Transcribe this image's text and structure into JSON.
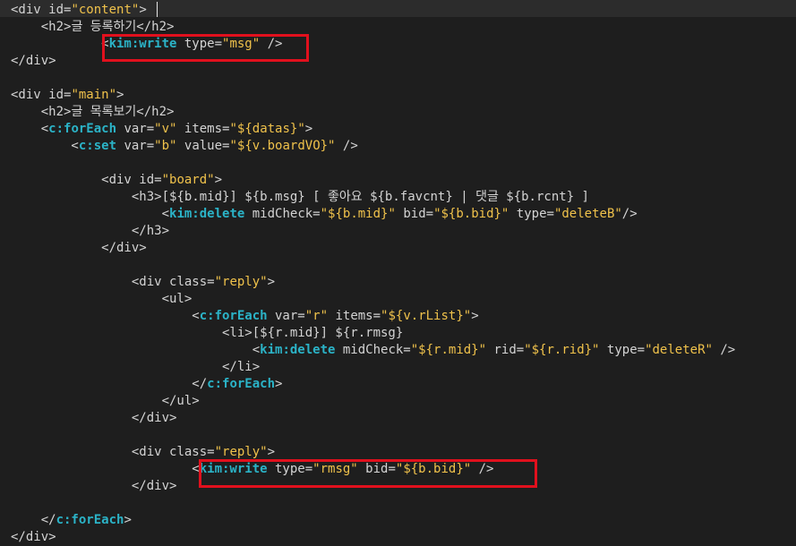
{
  "code_lines": [
    {
      "tokens": [
        {
          "c": "tag",
          "t": "<div "
        },
        {
          "c": "attr",
          "t": "id="
        },
        {
          "c": "str",
          "t": "\"content\""
        },
        {
          "c": "tag",
          "t": ">"
        }
      ]
    },
    {
      "tokens": [
        {
          "c": "tag",
          "t": "    <h2>"
        },
        {
          "c": "text",
          "t": "글 등록하기"
        },
        {
          "c": "tag",
          "t": "</h2>"
        }
      ]
    },
    {
      "tokens": [
        {
          "c": "tag",
          "t": "            <"
        },
        {
          "c": "kim",
          "t": "kim:write"
        },
        {
          "c": "attr",
          "t": " type="
        },
        {
          "c": "str",
          "t": "\"msg\""
        },
        {
          "c": "tag",
          "t": " />"
        }
      ]
    },
    {
      "tokens": [
        {
          "c": "tag",
          "t": "</div>"
        }
      ]
    },
    {
      "tokens": []
    },
    {
      "tokens": [
        {
          "c": "tag",
          "t": "<div "
        },
        {
          "c": "attr",
          "t": "id="
        },
        {
          "c": "str",
          "t": "\"main\""
        },
        {
          "c": "tag",
          "t": ">"
        }
      ]
    },
    {
      "tokens": [
        {
          "c": "tag",
          "t": "    <h2>"
        },
        {
          "c": "text",
          "t": "글 목록보기"
        },
        {
          "c": "tag",
          "t": "</h2>"
        }
      ]
    },
    {
      "tokens": [
        {
          "c": "tag",
          "t": "    <"
        },
        {
          "c": "kim",
          "t": "c:forEach"
        },
        {
          "c": "attr",
          "t": " var="
        },
        {
          "c": "str",
          "t": "\"v\""
        },
        {
          "c": "attr",
          "t": " items="
        },
        {
          "c": "str",
          "t": "\"${datas}\""
        },
        {
          "c": "tag",
          "t": ">"
        }
      ]
    },
    {
      "tokens": [
        {
          "c": "tag",
          "t": "        <"
        },
        {
          "c": "kim",
          "t": "c:set"
        },
        {
          "c": "attr",
          "t": " var="
        },
        {
          "c": "str",
          "t": "\"b\""
        },
        {
          "c": "attr",
          "t": " value="
        },
        {
          "c": "str",
          "t": "\"${v.boardVO}\""
        },
        {
          "c": "tag",
          "t": " />"
        }
      ]
    },
    {
      "tokens": []
    },
    {
      "tokens": [
        {
          "c": "tag",
          "t": "            <div "
        },
        {
          "c": "attr",
          "t": "id="
        },
        {
          "c": "str",
          "t": "\"board\""
        },
        {
          "c": "tag",
          "t": ">"
        }
      ]
    },
    {
      "tokens": [
        {
          "c": "tag",
          "t": "                <h3>"
        },
        {
          "c": "text",
          "t": "[${b.mid}] ${b.msg} [ 좋아요 ${b.favcnt} | 댓글 ${b.rcnt} ]"
        }
      ]
    },
    {
      "tokens": [
        {
          "c": "tag",
          "t": "                    <"
        },
        {
          "c": "kim",
          "t": "kim:delete"
        },
        {
          "c": "attr",
          "t": " midCheck="
        },
        {
          "c": "str",
          "t": "\"${b.mid}\""
        },
        {
          "c": "attr",
          "t": " bid="
        },
        {
          "c": "str",
          "t": "\"${b.bid}\""
        },
        {
          "c": "attr",
          "t": " type="
        },
        {
          "c": "str",
          "t": "\"deleteB\""
        },
        {
          "c": "tag",
          "t": "/>"
        }
      ]
    },
    {
      "tokens": [
        {
          "c": "tag",
          "t": "                </h3>"
        }
      ]
    },
    {
      "tokens": [
        {
          "c": "tag",
          "t": "            </div>"
        }
      ]
    },
    {
      "tokens": []
    },
    {
      "tokens": [
        {
          "c": "tag",
          "t": "                <div "
        },
        {
          "c": "attr",
          "t": "class="
        },
        {
          "c": "str",
          "t": "\"reply\""
        },
        {
          "c": "tag",
          "t": ">"
        }
      ]
    },
    {
      "tokens": [
        {
          "c": "tag",
          "t": "                    <ul>"
        }
      ]
    },
    {
      "tokens": [
        {
          "c": "tag",
          "t": "                        <"
        },
        {
          "c": "kim",
          "t": "c:forEach"
        },
        {
          "c": "attr",
          "t": " var="
        },
        {
          "c": "str",
          "t": "\"r\""
        },
        {
          "c": "attr",
          "t": " items="
        },
        {
          "c": "str",
          "t": "\"${v.rList}\""
        },
        {
          "c": "tag",
          "t": ">"
        }
      ]
    },
    {
      "tokens": [
        {
          "c": "tag",
          "t": "                            <li>"
        },
        {
          "c": "text",
          "t": "[${r.mid}] ${r.rmsg}"
        }
      ]
    },
    {
      "tokens": [
        {
          "c": "tag",
          "t": "                                <"
        },
        {
          "c": "kim",
          "t": "kim:delete"
        },
        {
          "c": "attr",
          "t": " midCheck="
        },
        {
          "c": "str",
          "t": "\"${r.mid}\""
        },
        {
          "c": "attr",
          "t": " rid="
        },
        {
          "c": "str",
          "t": "\"${r.rid}\""
        },
        {
          "c": "attr",
          "t": " type="
        },
        {
          "c": "str",
          "t": "\"deleteR\""
        },
        {
          "c": "tag",
          "t": " />"
        }
      ]
    },
    {
      "tokens": [
        {
          "c": "tag",
          "t": "                            </li>"
        }
      ]
    },
    {
      "tokens": [
        {
          "c": "tag",
          "t": "                        </"
        },
        {
          "c": "kim",
          "t": "c:forEach"
        },
        {
          "c": "tag",
          "t": ">"
        }
      ]
    },
    {
      "tokens": [
        {
          "c": "tag",
          "t": "                    </ul>"
        }
      ]
    },
    {
      "tokens": [
        {
          "c": "tag",
          "t": "                </div>"
        }
      ]
    },
    {
      "tokens": []
    },
    {
      "tokens": [
        {
          "c": "tag",
          "t": "                <div "
        },
        {
          "c": "attr",
          "t": "class="
        },
        {
          "c": "str",
          "t": "\"reply\""
        },
        {
          "c": "tag",
          "t": ">"
        }
      ]
    },
    {
      "tokens": [
        {
          "c": "tag",
          "t": "                        <"
        },
        {
          "c": "kim",
          "t": "kim:write"
        },
        {
          "c": "attr",
          "t": " type="
        },
        {
          "c": "str",
          "t": "\"rmsg\""
        },
        {
          "c": "attr",
          "t": " bid="
        },
        {
          "c": "str",
          "t": "\"${b.bid}\""
        },
        {
          "c": "tag",
          "t": " />"
        }
      ]
    },
    {
      "tokens": [
        {
          "c": "tag",
          "t": "                </div>"
        }
      ]
    },
    {
      "tokens": []
    },
    {
      "tokens": [
        {
          "c": "tag",
          "t": "    </"
        },
        {
          "c": "kim",
          "t": "c:forEach"
        },
        {
          "c": "tag",
          "t": ">"
        }
      ]
    },
    {
      "tokens": [
        {
          "c": "tag",
          "t": "</div>"
        }
      ]
    }
  ],
  "colors": {
    "background": "#1e1e1e",
    "tag": "#d4d4d4",
    "custom_tag": "#2bb3c7",
    "string": "#f0c24b",
    "highlight_box": "#e1101d"
  }
}
